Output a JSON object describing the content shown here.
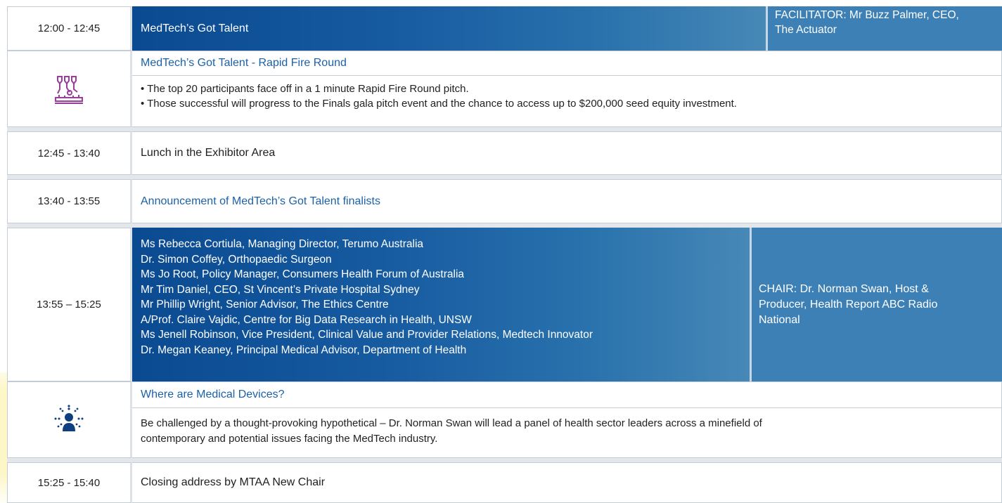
{
  "session1": {
    "time": "12:00 - 12:45",
    "title": "MedTech’s Got Talent",
    "facilitator_line1": "FACILITATOR: Mr Buzz Palmer, CEO,",
    "facilitator_line2": "The Actuator"
  },
  "rapid_fire": {
    "icon": "robotic-arms-icon",
    "title": "MedTech’s Got Talent - Rapid Fire Round",
    "bullets": [
      "• The top 20 participants face off in a 1 minute Rapid Fire Round pitch.",
      "• Those successful will progress to the Finals gala pitch event and the chance to access up to $200,000 seed equity investment."
    ]
  },
  "lunch": {
    "time": "12:45 - 13:40",
    "title": "Lunch in the Exhibitor Area"
  },
  "announcement": {
    "time": "13:40 - 13:55",
    "title": "Announcement of MedTech’s Got Talent finalists"
  },
  "panel": {
    "time": "13:55 – 15:25",
    "speakers": [
      "Ms Rebecca Cortiula, Managing Director, Terumo Australia",
      "Dr. Simon Coffey, Orthopaedic Surgeon",
      "Ms Jo Root, Policy Manager, Consumers Health Forum of Australia",
      "Mr Tim Daniel, CEO, St Vincent’s Private Hospital Sydney",
      "Mr Phillip Wright, Senior Advisor, The Ethics Centre",
      "A/Prof. Claire Vajdic, Centre for Big Data Research in Health, UNSW",
      "Ms Jenell Robinson, Vice President, Clinical Value and Provider Relations, Medtech Innovator",
      "Dr. Megan Keaney, Principal Medical Advisor, Department of Health"
    ],
    "chair_line1": "CHAIR: Dr. Norman Swan, Host &",
    "chair_line2": "Producer, Health Report ABC Radio",
    "chair_line3": "National"
  },
  "devices": {
    "icon": "person-radiating-icon",
    "title": "Where are Medical Devices?",
    "desc_line1": "Be challenged by a thought-provoking hypothetical – Dr. Norman Swan will lead a panel of health sector leaders across a minefield of",
    "desc_line2": "contemporary and potential issues facing the MedTech industry."
  },
  "closing": {
    "time": "15:25 - 15:40",
    "title": "Closing address by MTAA New Chair"
  },
  "colors": {
    "accent_blue": "#1c61a8",
    "header_dark": "#0a4a91",
    "side_blue": "#3d80b5",
    "icon_purple": "#9b3d9b",
    "icon_navy": "#0e3f80"
  }
}
